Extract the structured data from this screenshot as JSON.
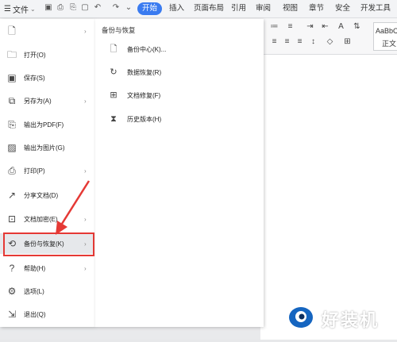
{
  "topbar": {
    "file_label": "文件",
    "tabs": [
      "开始",
      "插入",
      "页面布局",
      "引用",
      "审阅",
      "视图",
      "章节",
      "安全",
      "开发工具"
    ]
  },
  "ribbon": {
    "style_preview": "AaBbCc",
    "style_name": "正文"
  },
  "menu": {
    "items": [
      {
        "label": "",
        "icon": "new-doc-icon"
      },
      {
        "label": "打开(O)",
        "icon": "folder-icon"
      },
      {
        "label": "保存(S)",
        "icon": "save-icon"
      },
      {
        "label": "另存为(A)",
        "icon": "save-as-icon"
      },
      {
        "label": "输出为PDF(F)",
        "icon": "pdf-icon"
      },
      {
        "label": "输出为图片(G)",
        "icon": "image-icon"
      },
      {
        "label": "打印(P)",
        "icon": "print-icon"
      },
      {
        "label": "分享文档(D)",
        "icon": "share-icon"
      },
      {
        "label": "文档加密(E)",
        "icon": "lock-doc-icon"
      },
      {
        "label": "备份与恢复(K)",
        "icon": "backup-icon"
      },
      {
        "label": "帮助(H)",
        "icon": "help-icon"
      },
      {
        "label": "选项(L)",
        "icon": "gear-icon"
      },
      {
        "label": "退出(Q)",
        "icon": "exit-icon"
      }
    ]
  },
  "submenu": {
    "title": "备份与恢复",
    "items": [
      {
        "label": "备份中心(K)...",
        "icon": "backup-center-icon"
      },
      {
        "label": "数据恢复(R)",
        "icon": "refresh-icon"
      },
      {
        "label": "文档修复(F)",
        "icon": "repair-icon"
      },
      {
        "label": "历史版本(H)",
        "icon": "history-icon"
      }
    ]
  },
  "watermark": {
    "text": "好装机"
  },
  "colors": {
    "accent": "#3a7bf0",
    "highlight_border": "#e53935",
    "arrow": "#e53935"
  }
}
